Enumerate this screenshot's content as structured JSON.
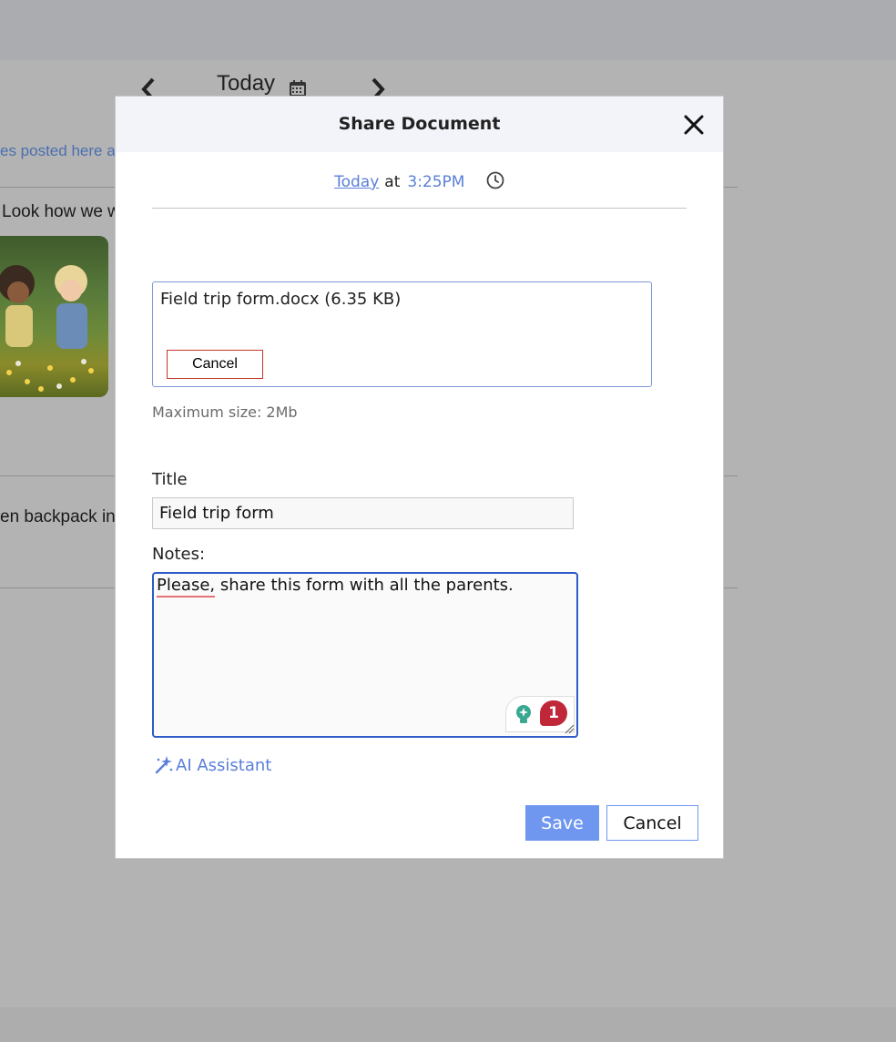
{
  "background": {
    "date_title": "Today",
    "nav_prev": "‹",
    "nav_next": "›",
    "link_fragment": "es posted here ar",
    "post1_text": "Look how we w",
    "post2_text": "en backpack in"
  },
  "modal": {
    "title": "Share Document",
    "close_icon": "close-icon",
    "date_link": "Today",
    "at_text": "at",
    "time_link": "3:25PM",
    "file": {
      "name": "Field trip form.docx (6.35 KB)",
      "cancel_label": "Cancel"
    },
    "max_size": "Maximum size: 2Mb",
    "title_label": "Title",
    "title_value": "Field trip form",
    "notes_label": "Notes:",
    "notes_value": "Please, share this form with all the parents.",
    "grammarly_count": "1",
    "ai_assistant_label": "AI Assistant",
    "save_label": "Save",
    "cancel_label": "Cancel"
  },
  "colors": {
    "accent": "#6f97ef",
    "link": "#5a7fd8",
    "focus_border": "#2f5bc8",
    "error_red": "#c0392b"
  }
}
